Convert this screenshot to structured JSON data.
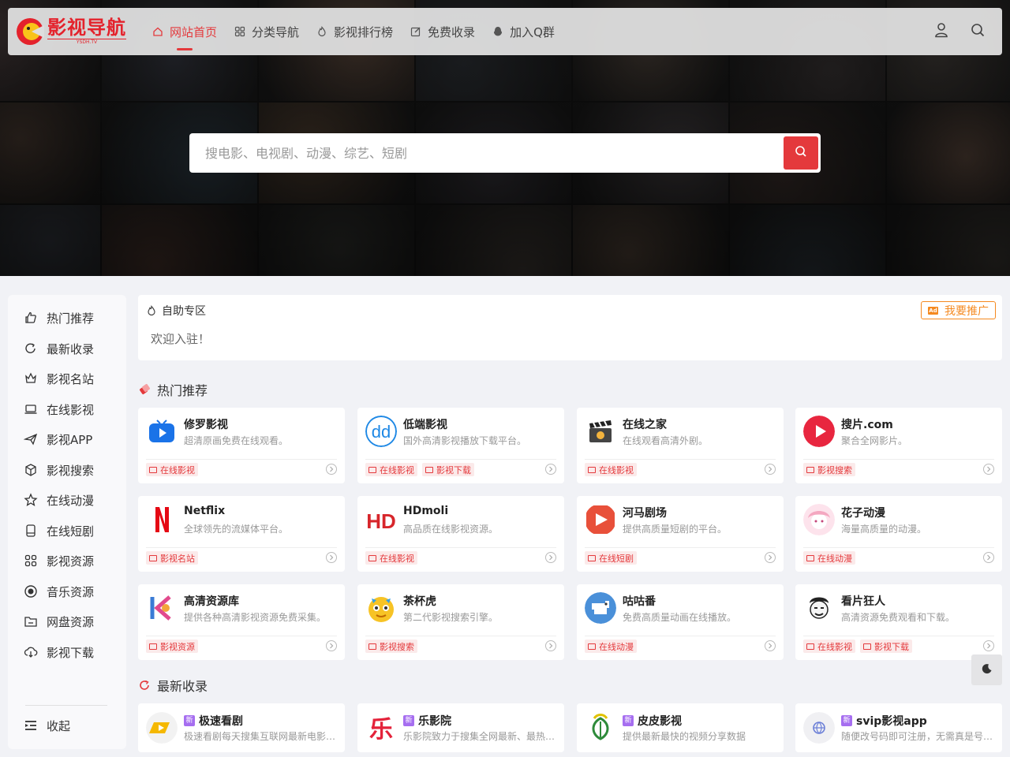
{
  "site": {
    "logo_text": "影视导航",
    "logo_sub": "YSDH.TV"
  },
  "nav": [
    {
      "label": "网站首页",
      "icon": "home-icon",
      "active": true
    },
    {
      "label": "分类导航",
      "icon": "grid-icon"
    },
    {
      "label": "影视排行榜",
      "icon": "flame-icon"
    },
    {
      "label": "免费收录",
      "icon": "edit-icon"
    },
    {
      "label": "加入Q群",
      "icon": "qq-icon"
    }
  ],
  "search": {
    "placeholder": "搜电影、电视剧、动漫、综艺、短剧"
  },
  "sidebar": {
    "items": [
      {
        "label": "热门推荐",
        "icon": "thumbs-up-icon"
      },
      {
        "label": "最新收录",
        "icon": "refresh-icon"
      },
      {
        "label": "影视名站",
        "icon": "crown-icon"
      },
      {
        "label": "在线影视",
        "icon": "laptop-icon"
      },
      {
        "label": "影视APP",
        "icon": "send-icon"
      },
      {
        "label": "影视搜索",
        "icon": "cube-icon"
      },
      {
        "label": "在线动漫",
        "icon": "star-icon"
      },
      {
        "label": "在线短剧",
        "icon": "phone-icon"
      },
      {
        "label": "影视资源",
        "icon": "apps-icon"
      },
      {
        "label": "音乐资源",
        "icon": "record-icon"
      },
      {
        "label": "网盘资源",
        "icon": "folder-icon"
      },
      {
        "label": "影视下载",
        "icon": "cloud-download-icon"
      }
    ],
    "collapse_label": "收起"
  },
  "self_service": {
    "title": "自助专区",
    "text": "欢迎入驻！",
    "ad_label": "我要推广",
    "ad_badge": "Ad"
  },
  "hot": {
    "title": "热门推荐",
    "cards": [
      {
        "name": "修罗影视",
        "desc": "超清原画免费在线观看。",
        "tags": [
          "在线影视"
        ],
        "icon": "play-tv-icon",
        "color": "#1a73e8"
      },
      {
        "name": "低端影视",
        "desc": "国外高清影视播放下载平台。",
        "tags": [
          "在线影视",
          "影视下载"
        ],
        "icon": "dd-logo-icon",
        "color": "#1e88e5"
      },
      {
        "name": "在线之家",
        "desc": "在线观看高清外剧。",
        "tags": [
          "在线影视"
        ],
        "icon": "clapper-icon",
        "color": "#444444"
      },
      {
        "name": "搜片.com",
        "desc": "聚合全网影片。",
        "tags": [
          "影视搜索"
        ],
        "icon": "play-circle-icon",
        "color": "#e8263f"
      },
      {
        "name": "Netflix",
        "desc": "全球领先的流媒体平台。",
        "tags": [
          "影视名站"
        ],
        "icon": "netflix-icon",
        "color": "#e50914"
      },
      {
        "name": "HDmoli",
        "desc": "高品质在线影视资源。",
        "tags": [
          "在线影视"
        ],
        "icon": "hd-icon",
        "color": "#d7262b"
      },
      {
        "name": "河马剧场",
        "desc": "提供高质量短剧的平台。",
        "tags": [
          "在线短剧"
        ],
        "icon": "hippo-play-icon",
        "color": "#e8503a"
      },
      {
        "name": "花子动漫",
        "desc": "海量高质量的动漫。",
        "tags": [
          "在线动漫"
        ],
        "icon": "anime-girl-icon",
        "color": "#f4a7c0"
      },
      {
        "name": "高清资源库",
        "desc": "提供各种高清影视资源免费采集。",
        "tags": [
          "影视资源"
        ],
        "icon": "k-logo-icon",
        "color": "#3a7bd5"
      },
      {
        "name": "茶杯虎",
        "desc": "第二代影视搜索引擎。",
        "tags": [
          "影视搜索"
        ],
        "icon": "tiger-icon",
        "color": "#f7c325"
      },
      {
        "name": "咕咕番",
        "desc": "免费高质量动画在线播放。",
        "tags": [
          "在线动漫"
        ],
        "icon": "pigeon-icon",
        "color": "#4a90d9"
      },
      {
        "name": "看片狂人",
        "desc": "高清资源免费观看和下载。",
        "tags": [
          "在线影视",
          "影视下载"
        ],
        "icon": "meme-face-icon",
        "color": "#333333"
      }
    ]
  },
  "latest": {
    "title": "最新收录",
    "badge": "新",
    "cards": [
      {
        "name": "极速看剧",
        "desc": "极速看剧每天搜集互联网最新电影、电视剧、动漫",
        "icon": "fast-play-icon",
        "color": "#f5b800"
      },
      {
        "name": "乐影院",
        "desc": "乐影院致力于搜集全网最新、最热门的影视资源",
        "icon": "le-logo-icon",
        "color": "#e4223a"
      },
      {
        "name": "皮皮影视",
        "desc": "提供最新最快的视频分享数据",
        "icon": "leaf-icon",
        "color": "#2e8b3a"
      },
      {
        "name": "svip影视app",
        "desc": "随便改号码即可注册，无需真是号码验证",
        "icon": "globe-icon",
        "color": "#6b7fd7"
      }
    ]
  },
  "colors": {
    "accent": "#e4393c",
    "orange": "#f5891f",
    "new_badge": "#a66ef0"
  }
}
